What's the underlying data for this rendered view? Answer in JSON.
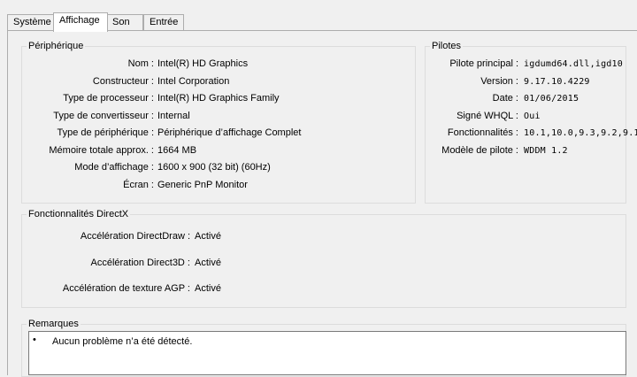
{
  "tabs": [
    {
      "label": "Système"
    },
    {
      "label": "Affichage"
    },
    {
      "label": "Son"
    },
    {
      "label": "Entrée"
    }
  ],
  "device": {
    "title": "Périphérique",
    "rows": [
      {
        "label": "Nom :",
        "value": "Intel(R) HD Graphics"
      },
      {
        "label": "Constructeur :",
        "value": "Intel Corporation"
      },
      {
        "label": "Type de processeur :",
        "value": "Intel(R) HD Graphics Family"
      },
      {
        "label": "Type de convertisseur :",
        "value": "Internal"
      },
      {
        "label": "Type de périphérique :",
        "value": "Périphérique d’affichage Complet"
      },
      {
        "label": "Mémoire totale approx. :",
        "value": "1664 MB"
      },
      {
        "label": "Mode d’affichage :",
        "value": "1600 x 900 (32 bit) (60Hz)"
      },
      {
        "label": "Écran :",
        "value": "Generic PnP Monitor"
      }
    ]
  },
  "drivers": {
    "title": "Pilotes",
    "rows": [
      {
        "label": "Pilote principal :",
        "value": "igdumd64.dll,igd10"
      },
      {
        "label": "Version :",
        "value": "9.17.10.4229"
      },
      {
        "label": "Date :",
        "value": "01/06/2015"
      },
      {
        "label": "Signé WHQL :",
        "value": "Oui"
      },
      {
        "label": "Fonctionnalités :",
        "value": "10.1,10.0,9.3,9.2,9.1"
      },
      {
        "label": "Modèle de pilote :",
        "value": "WDDM 1.2"
      }
    ]
  },
  "directx": {
    "title": "Fonctionnalités DirectX",
    "rows": [
      {
        "label": "Accélération DirectDraw :",
        "value": "Activé"
      },
      {
        "label": "Accélération Direct3D :",
        "value": "Activé"
      },
      {
        "label": "Accélération de texture AGP :",
        "value": "Activé"
      }
    ]
  },
  "notes": {
    "title": "Remarques",
    "bullet": "•",
    "items": [
      "Aucun problème n’a été détecté."
    ]
  }
}
